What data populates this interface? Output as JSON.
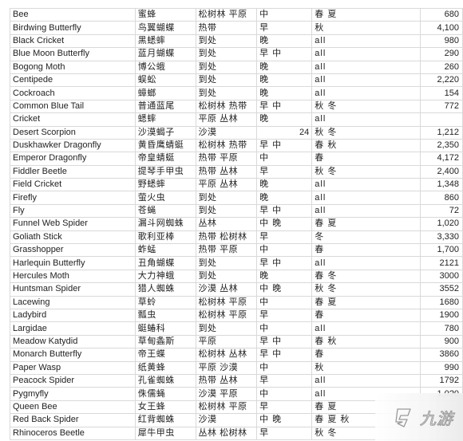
{
  "table": {
    "rows": [
      {
        "name": "Bee",
        "cn": "蜜蜂",
        "habitat": "松树林 平原",
        "time": "中",
        "season": "春 夏",
        "price": "680"
      },
      {
        "name": "Birdwing Butterfly",
        "cn": "鸟翼蝴蝶",
        "habitat": "热带",
        "time": "早",
        "season": "秋",
        "price": "4,100"
      },
      {
        "name": "Black Cricket",
        "cn": "黑蟋蟀",
        "habitat": "到处",
        "time": "晚",
        "season": "all",
        "price": "980"
      },
      {
        "name": "Blue Moon Butterfly",
        "cn": "蓝月蝴蝶",
        "habitat": "到处",
        "time": "早 中",
        "season": "all",
        "price": "290"
      },
      {
        "name": "Bogong Moth",
        "cn": "博公蛾",
        "habitat": "到处",
        "time": "晚",
        "season": "all",
        "price": "260"
      },
      {
        "name": "Centipede",
        "cn": "蜈蚣",
        "habitat": "到处",
        "time": "晚",
        "season": "all",
        "price": "2,220"
      },
      {
        "name": "Cockroach",
        "cn": "蟑螂",
        "habitat": "到处",
        "time": "晚",
        "season": "all",
        "price": "154"
      },
      {
        "name": "Common Blue Tail",
        "cn": "普通蓝尾",
        "habitat": "松树林 热带",
        "time": "早 中",
        "season": "秋 冬",
        "price": "772"
      },
      {
        "name": "Cricket",
        "cn": "蟋蟀",
        "habitat": "平原 丛林",
        "time": "晚",
        "season": "all",
        "price": ""
      },
      {
        "name": "Desert Scorpion",
        "cn": "沙漠蝎子",
        "habitat": "沙漠",
        "time": "24",
        "season": "秋 冬",
        "price": "1,212",
        "time_numeric": true
      },
      {
        "name": "Duskhawker Dragonfly",
        "cn": "黄昏鹰蜻蜓",
        "habitat": "松树林 热带",
        "time": "早 中",
        "season": "春 秋",
        "price": "2,350"
      },
      {
        "name": "Emperor Dragonfly",
        "cn": "帝皇蜻蜓",
        "habitat": "热带 平原",
        "time": "中",
        "season": "春",
        "price": "4,172"
      },
      {
        "name": "Fiddler Beetle",
        "cn": "提琴手甲虫",
        "habitat": "热带 丛林",
        "time": "早",
        "season": "秋 冬",
        "price": "2,400"
      },
      {
        "name": "Field Cricket",
        "cn": "野蟋蟀",
        "habitat": "平原 丛林",
        "time": "晚",
        "season": "all",
        "price": "1,348"
      },
      {
        "name": "Firefly",
        "cn": "萤火虫",
        "habitat": "到处",
        "time": "晚",
        "season": "all",
        "price": "860"
      },
      {
        "name": "Fly",
        "cn": "苍蝇",
        "habitat": "到处",
        "time": "早 中",
        "season": "all",
        "price": "72"
      },
      {
        "name": "Funnel Web Spider",
        "cn": "漏斗网蜘蛛",
        "habitat": "丛林",
        "time": "中 晚",
        "season": "春 夏",
        "price": "1,020"
      },
      {
        "name": "Goliath Stick",
        "cn": "歌利亚棒",
        "habitat": "热带 松树林",
        "time": "早",
        "season": "冬",
        "price": "3,330"
      },
      {
        "name": "Grasshopper",
        "cn": "蚱蜢",
        "habitat": "热带 平原",
        "time": "中",
        "season": "春",
        "price": "1,700"
      },
      {
        "name": "Harlequin Butterfly",
        "cn": "丑角蝴蝶",
        "habitat": "到处",
        "time": "早 中",
        "season": "all",
        "price": "2121"
      },
      {
        "name": "Hercules Moth",
        "cn": "大力神蛾",
        "habitat": "到处",
        "time": "晚",
        "season": "春 冬",
        "price": "3000"
      },
      {
        "name": "Huntsman Spider",
        "cn": "猎人蜘蛛",
        "habitat": "沙漠 丛林",
        "time": "中 晚",
        "season": "秋 冬",
        "price": "3552"
      },
      {
        "name": "Lacewing",
        "cn": "草蛉",
        "habitat": "松树林 平原",
        "time": "中",
        "season": "春 夏",
        "price": "1680"
      },
      {
        "name": "Ladybird",
        "cn": "瓢虫",
        "habitat": "松树林 平原",
        "time": "早",
        "season": "春",
        "price": "1900"
      },
      {
        "name": "Largidae",
        "cn": "蜓蝽科",
        "habitat": "到处",
        "time": "中",
        "season": "all",
        "price": "780"
      },
      {
        "name": "Meadow Katydid",
        "cn": "草甸螽斯",
        "habitat": "平原",
        "time": "早 中",
        "season": "春 秋",
        "price": "900"
      },
      {
        "name": "Monarch Butterfly",
        "cn": "帝王蝶",
        "habitat": "松树林 丛林",
        "time": "早 中",
        "season": "春",
        "price": "3860"
      },
      {
        "name": "Paper Wasp",
        "cn": "纸黄蜂",
        "habitat": "平原 沙漠",
        "time": "中",
        "season": "秋",
        "price": "990"
      },
      {
        "name": "Peacock Spider",
        "cn": "孔雀蜘蛛",
        "habitat": "热带 丛林",
        "time": "早",
        "season": "all",
        "price": "1792"
      },
      {
        "name": "Pygmyfly",
        "cn": "侏儒蝇",
        "habitat": "沙漠 平原",
        "time": "中",
        "season": "all",
        "price": "1,0?0"
      },
      {
        "name": "Queen Bee",
        "cn": "女王蜂",
        "habitat": "松树林 平原",
        "time": "早",
        "season": "春 夏",
        "price": ""
      },
      {
        "name": "Red Back Spider",
        "cn": "红背蜘蛛",
        "habitat": "沙漠",
        "time": "中 晚",
        "season": "春 夏 秋",
        "price": ""
      },
      {
        "name": "Rhinoceros Beetle",
        "cn": "犀牛甲虫",
        "habitat": "丛林 松树林",
        "time": "早",
        "season": "秋 冬",
        "price": ""
      }
    ]
  },
  "watermark": {
    "text": "九游",
    "icon": "jiuyou-logo-icon"
  }
}
